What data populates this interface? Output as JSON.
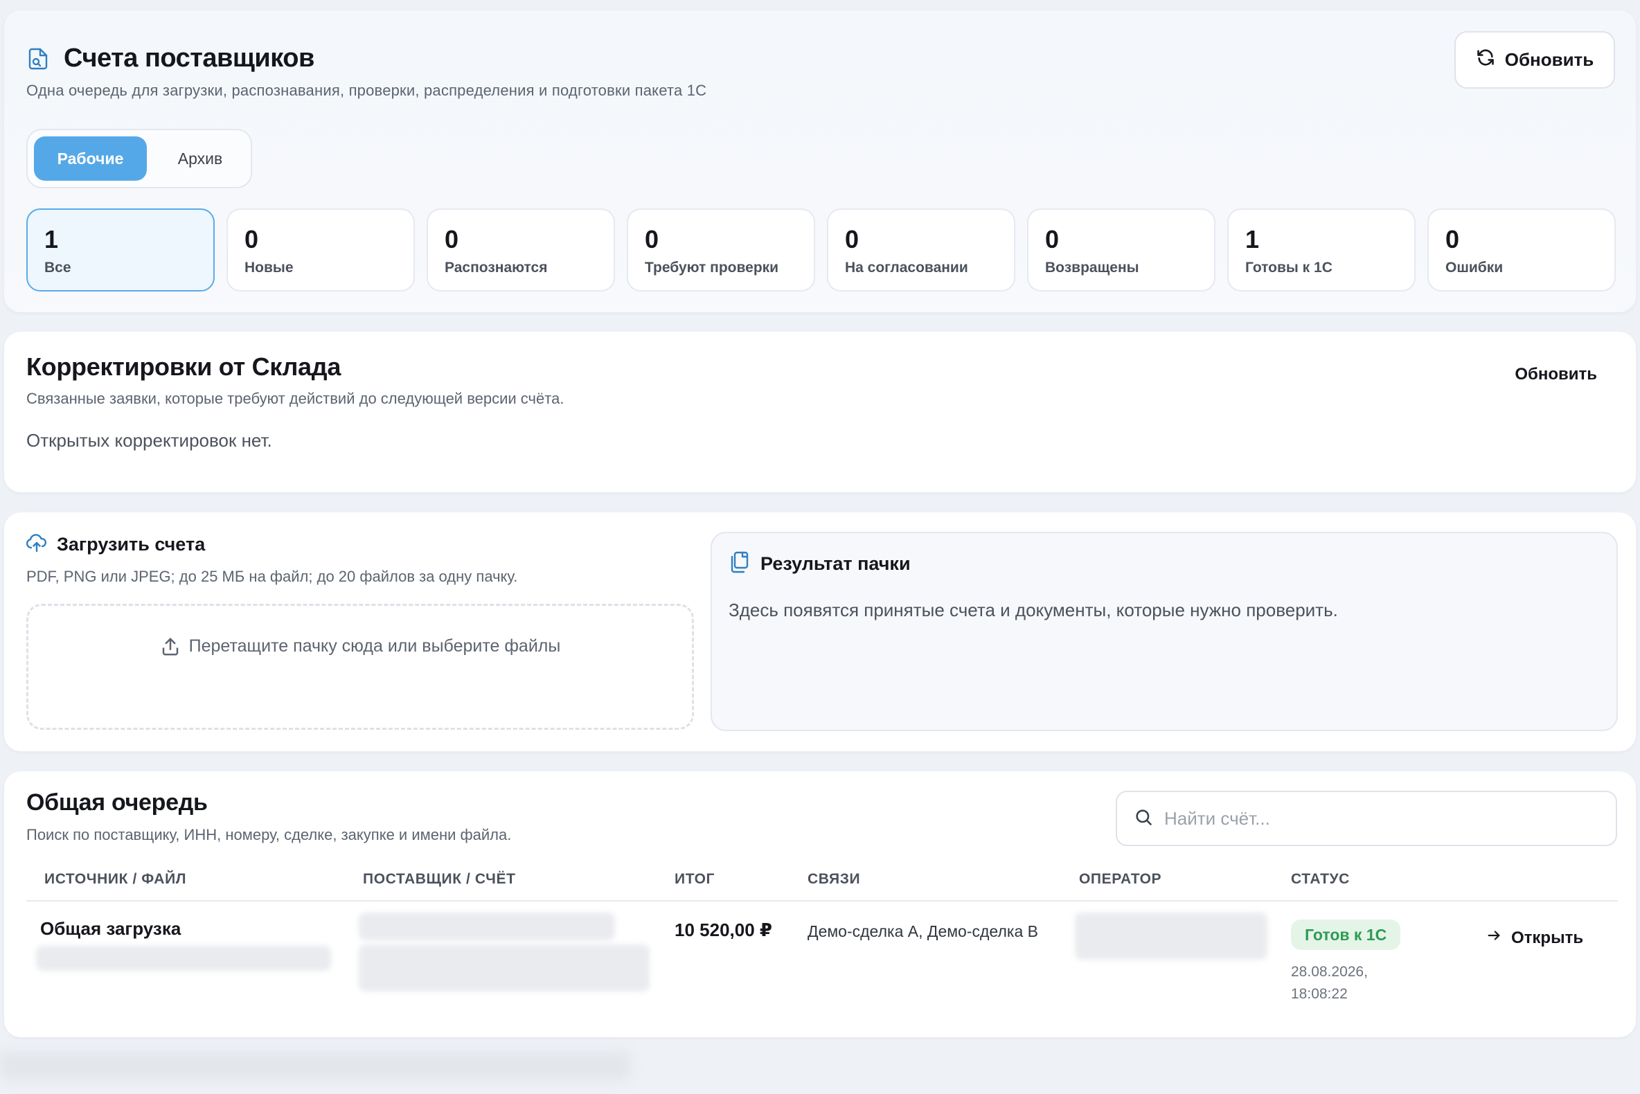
{
  "header": {
    "title": "Счета поставщиков",
    "subtitle": "Одна очередь для загрузки, распознавания, проверки, распределения и подготовки пакета 1С",
    "refresh_label": "Обновить",
    "title_icon": "document-search-icon",
    "refresh_icon": "refresh-icon"
  },
  "tabs": [
    {
      "label": "Рабочие",
      "active": true
    },
    {
      "label": "Архив",
      "active": false
    }
  ],
  "stats": [
    {
      "value": "1",
      "label": "Все",
      "active": true
    },
    {
      "value": "0",
      "label": "Новые"
    },
    {
      "value": "0",
      "label": "Распознаются"
    },
    {
      "value": "0",
      "label": "Требуют проверки"
    },
    {
      "value": "0",
      "label": "На согласовании"
    },
    {
      "value": "0",
      "label": "Возвращены"
    },
    {
      "value": "1",
      "label": "Готовы к 1С"
    },
    {
      "value": "0",
      "label": "Ошибки"
    }
  ],
  "corrections": {
    "title": "Корректировки от Склада",
    "subtitle": "Связанные заявки, которые требуют действий до следующей версии счёта.",
    "empty_text": "Открытых корректировок нет.",
    "refresh_label": "Обновить"
  },
  "upload": {
    "title": "Загрузить счета",
    "subtitle": "PDF, PNG или JPEG; до 25 МБ на файл; до 20 файлов за одну пачку.",
    "dropzone_text": "Перетащите пачку сюда или выберите файлы",
    "upload_icon": "cloud-upload-icon"
  },
  "batch_result": {
    "title": "Результат пачки",
    "text": "Здесь появятся принятые счета и документы, которые нужно проверить.",
    "icon": "copy-documents-icon"
  },
  "queue": {
    "title": "Общая очередь",
    "subtitle": "Поиск по поставщику, ИНН, номеру, сделке, закупке и имени файла.",
    "search_placeholder": "Найти счёт...",
    "columns": [
      "ИСТОЧНИК / ФАЙЛ",
      "ПОСТАВЩИК / СЧЁТ",
      "ИТОГ",
      "СВЯЗИ",
      "ОПЕРАТОР",
      "СТАТУС"
    ],
    "rows": [
      {
        "source": "Общая загрузка",
        "amount": "10 520,00 ₽",
        "links": "Демо-сделка А, Демо-сделка В",
        "status": "Готов к 1С",
        "status_date": "28.08.2026, 18:08:22",
        "open_label": "Открыть"
      }
    ]
  },
  "colors": {
    "accent": "#55a8e8",
    "status_ok_bg": "#e4f5e8",
    "status_ok_text": "#2f9a55",
    "icon_blue": "#2f7fc1"
  }
}
